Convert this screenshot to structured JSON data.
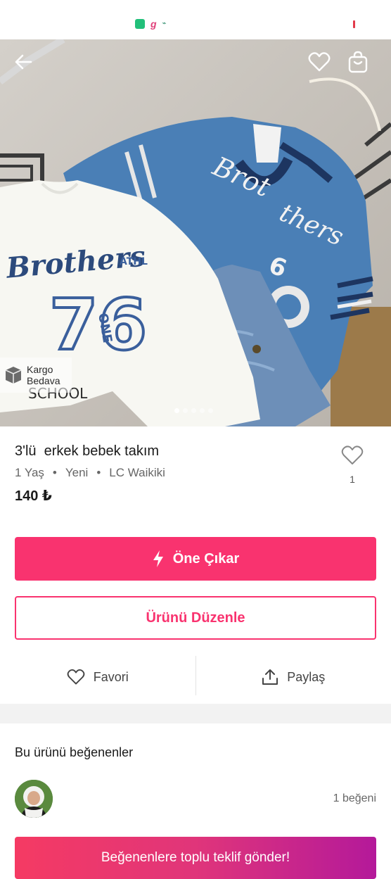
{
  "status_bar": {
    "apps": [
      "app-1",
      "app-2",
      "app-3"
    ]
  },
  "header": {
    "back_icon": "arrow-left-icon",
    "favorite_icon": "heart-icon",
    "cart_icon": "shopping-bag-icon"
  },
  "gallery": {
    "badge": {
      "line1": "Kargo",
      "line2": "Bedava",
      "icon": "box-icon"
    },
    "image_count": 5,
    "active_index": 0,
    "print_front": "Brothers",
    "print_number": "76",
    "print_small": "ATHL"
  },
  "product": {
    "title": "3'lü  erkek bebek takım",
    "age": "1 Yaş",
    "condition": "Yeni",
    "brand": "LC Waikiki",
    "price": "140 ₺",
    "like_count": "1"
  },
  "buttons": {
    "promote_label": "Öne Çıkar",
    "edit_label": "Ürünü Düzenle"
  },
  "actions": {
    "favorite_label": "Favori",
    "share_label": "Paylaş"
  },
  "likers": {
    "title": "Bu ürünü beğenenler",
    "count_text": "1 beğeni",
    "offer_button": "Beğenenlere toplu teklif gönder!"
  },
  "colors": {
    "brand": "#f9336f",
    "gradient_end": "#b4199a"
  }
}
